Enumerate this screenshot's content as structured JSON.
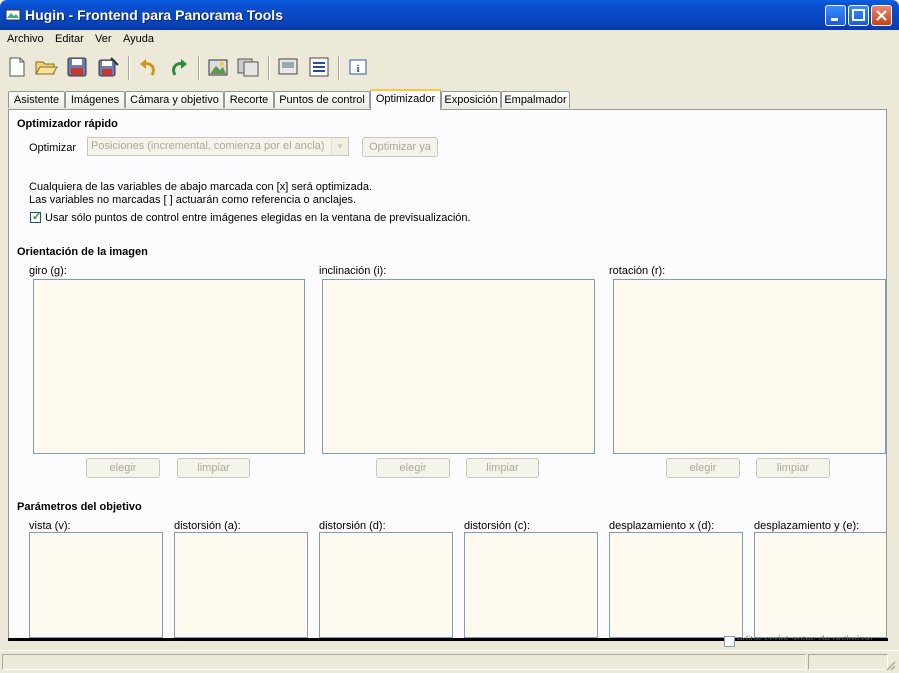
{
  "window": {
    "title": "Hugin - Frontend para Panorama Tools"
  },
  "menu": [
    "Archivo",
    "Editar",
    "Ver",
    "Ayuda"
  ],
  "toolbar": [
    "new-icon",
    "open-icon",
    "save-icon",
    "save-as-icon",
    "undo-icon",
    "redo-icon",
    "add-images-icon",
    "add-series-icon",
    "preview-icon",
    "properties-icon",
    "about-icon"
  ],
  "tabs": [
    {
      "label": "Asistente"
    },
    {
      "label": "Imágenes"
    },
    {
      "label": "Cámara y objetivo"
    },
    {
      "label": "Recorte"
    },
    {
      "label": "Puntos de control"
    },
    {
      "label": "Optimizador",
      "active": true
    },
    {
      "label": "Exposición"
    },
    {
      "label": "Empalmador"
    }
  ],
  "quick": {
    "heading": "Optimizador rápido",
    "optimize_label": "Optimizar",
    "optimize_value": "Posiciones (incremental, comienza por el ancla)",
    "optimize_now": "Optimizar ya",
    "info_line1": "Cualquiera de las variables de abajo marcada con [x] será optimizada.",
    "info_line2": "Las variables no marcadas [ ] actuarán como referencia o anclajes.",
    "checkbox_label": "Usar sólo puntos de control entre imágenes elegidas en la ventana de previsualización."
  },
  "orientation": {
    "heading": "Orientación de la imagen",
    "columns": [
      {
        "label": "giro (g):",
        "select": "elegir",
        "clear": "limpiar"
      },
      {
        "label": "inclinación (i):",
        "select": "elegir",
        "clear": "limpiar"
      },
      {
        "label": "rotación (r):",
        "select": "elegir",
        "clear": "limpiar"
      }
    ]
  },
  "lens": {
    "heading": "Parámetros del objetivo",
    "columns": [
      "vista (v):",
      "distorsión (a):",
      "distorsión (d):",
      "distorsión (c):",
      "desplazamiento x (d):",
      "desplazamiento y (e):"
    ]
  },
  "footer": {
    "edit_script_label": "editar script antes de optimizar"
  }
}
